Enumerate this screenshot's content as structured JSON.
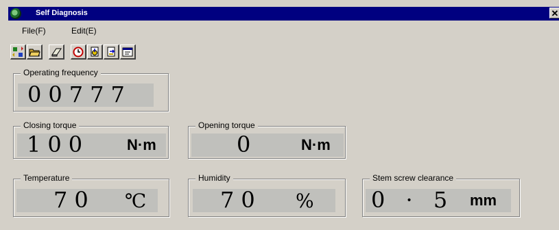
{
  "window": {
    "title": "Self Diagnosis",
    "close_glyph": "✕",
    "title_bar_color": "#000080",
    "app_icon": "globe-icon"
  },
  "menu": {
    "items": [
      {
        "label": "File(F)"
      },
      {
        "label": "Edit(E)"
      }
    ]
  },
  "toolbar": {
    "buttons": [
      {
        "icon": "transfer-icon"
      },
      {
        "icon": "folder-open-icon"
      },
      {
        "icon": "eraser-icon"
      },
      {
        "icon": "timer-icon"
      },
      {
        "icon": "document-download-icon"
      },
      {
        "icon": "document-export-icon"
      },
      {
        "icon": "settings-window-icon"
      }
    ]
  },
  "panels": {
    "operating_frequency": {
      "label": "Operating frequency",
      "value": "00777"
    },
    "closing_torque": {
      "label": "Closing torque",
      "value": "100",
      "unit": "N·m"
    },
    "opening_torque": {
      "label": "Opening torque",
      "value": "0",
      "unit": "N·m"
    },
    "temperature": {
      "label": "Temperature",
      "value": "70",
      "unit": "℃"
    },
    "humidity": {
      "label": "Humidity",
      "value": "70",
      "unit": "%"
    },
    "stem_screw_clearance": {
      "label": "Stem screw clearance",
      "value": "0 · 5",
      "unit": "mm"
    }
  }
}
